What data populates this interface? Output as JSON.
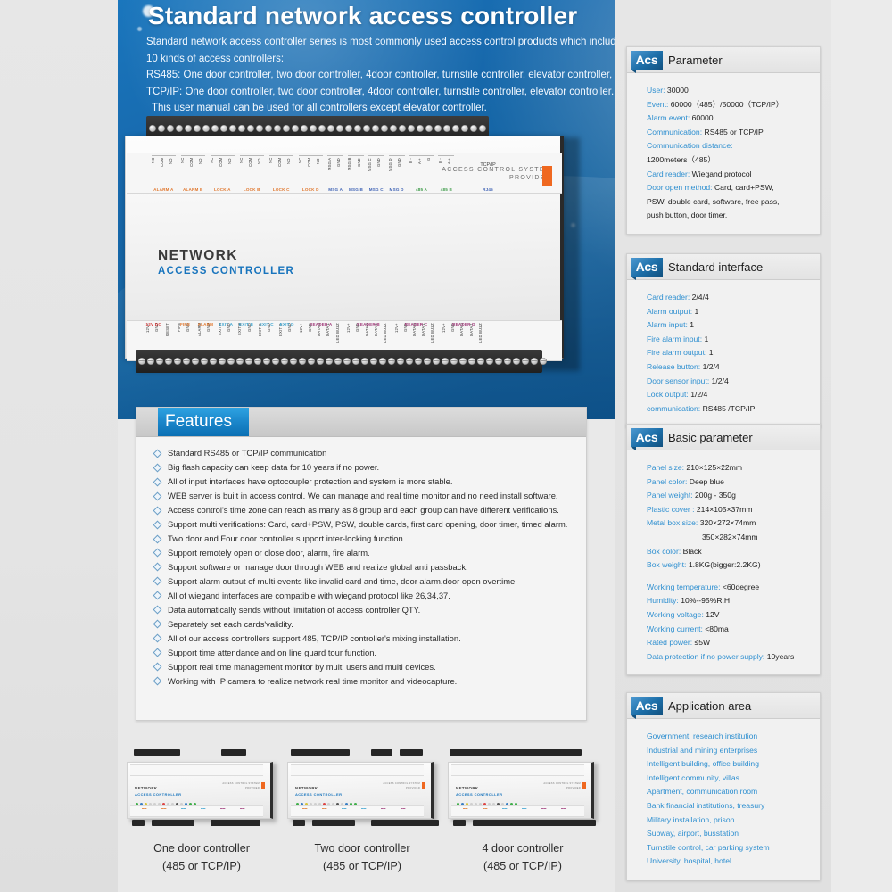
{
  "hero": {
    "title": "Standard network access controller",
    "lines": [
      "Standard network access controller series is most commonly used access control products which include",
      "10 kinds of access controllers:",
      "RS485:  One door controller, two door controller, 4door controller, turnstile controller, elevator controller,",
      "TCP/IP:  One door controller, two door controller, 4door controller, turnstile controller, elevator controller.",
      "This user manual can be used for all controllers except elevator controller."
    ]
  },
  "device": {
    "brand_line1": "ACCESS  CONTROL  SYSTEM",
    "brand_line2": "PROVIDER",
    "name_line1": "NETWORK",
    "name_line2": "ACCESS CONTROLLER",
    "top_groups": [
      {
        "name": "ALARM A",
        "color": "#e0762c",
        "pins": [
          "NC",
          "COM",
          "NO"
        ]
      },
      {
        "name": "ALARM B",
        "color": "#e0762c",
        "pins": [
          "NC",
          "COM",
          "NO"
        ]
      },
      {
        "name": "LOCK A",
        "color": "#e0762c",
        "pins": [
          "NC",
          "COM",
          "NO"
        ]
      },
      {
        "name": "LOCK B",
        "color": "#e0762c",
        "pins": [
          "NC",
          "COM",
          "NO"
        ]
      },
      {
        "name": "LOCK C",
        "color": "#e0762c",
        "pins": [
          "NC",
          "COM",
          "NO"
        ]
      },
      {
        "name": "LOCK D",
        "color": "#e0762c",
        "pins": [
          "NC",
          "COM",
          "NO"
        ]
      },
      {
        "name": "MSG A",
        "color": "#3f63b5",
        "pins": [
          "MSG A",
          "GND"
        ]
      },
      {
        "name": "MSG B",
        "color": "#3f63b5",
        "pins": [
          "MSG B",
          "GND"
        ]
      },
      {
        "name": "MSG C",
        "color": "#3f63b5",
        "pins": [
          "MSG C",
          "GND"
        ]
      },
      {
        "name": "MSG D",
        "color": "#3f63b5",
        "pins": [
          "MSG D",
          "GND"
        ]
      },
      {
        "name": "485 A",
        "color": "#3f9c4a",
        "pins": [
          "B -",
          "A +",
          "G"
        ]
      },
      {
        "name": "485 B",
        "color": "#3f9c4a",
        "pins": [
          "B -",
          "A +"
        ]
      },
      {
        "name": "RJ45",
        "color": "#3f63b5",
        "pins": []
      }
    ],
    "top_right_label": "TCP/IP",
    "bottom_groups": [
      {
        "name": "12V DC",
        "color": "#d33a3a",
        "pins": [
          "12V+",
          "GND"
        ]
      },
      {
        "name": "",
        "color": "#2b2b2b",
        "pins": [
          "RESET"
        ]
      },
      {
        "name": "FIRE",
        "color": "#e0762c",
        "pins": [
          "FIRE",
          "GND"
        ]
      },
      {
        "name": "ALARM",
        "color": "#e0762c",
        "pins": [
          "ALARM",
          "GND"
        ]
      },
      {
        "name": "EXIT A",
        "color": "#3aa3cf",
        "pins": [
          "EXIT A",
          "GND"
        ]
      },
      {
        "name": "EXIT B",
        "color": "#3aa3cf",
        "pins": [
          "EXIT B",
          "GND"
        ]
      },
      {
        "name": "EXIT C",
        "color": "#3aa3cf",
        "pins": [
          "EXIT C",
          "GND"
        ]
      },
      {
        "name": "EXIT D",
        "color": "#3aa3cf",
        "pins": [
          "EXIT D",
          "GND"
        ]
      },
      {
        "name": "READER A",
        "color": "#a03a7a",
        "pins": [
          "12V+",
          "GND",
          "DATA 0",
          "DATA 1",
          "LED BUZZ"
        ]
      },
      {
        "name": "READER B",
        "color": "#a03a7a",
        "pins": [
          "12V+",
          "GND",
          "DATA 0",
          "DATA 1",
          "LED BUZZ"
        ]
      },
      {
        "name": "READER C",
        "color": "#a03a7a",
        "pins": [
          "12V+",
          "GND",
          "DATA 0",
          "DATA 1",
          "LED BUZZ"
        ]
      },
      {
        "name": "READER D",
        "color": "#a03a7a",
        "pins": [
          "12V+",
          "GND",
          "DATA 0",
          "DATA 1",
          "LED BUZZ"
        ]
      }
    ]
  },
  "features": {
    "heading": "Features",
    "items": [
      "Standard RS485 or TCP/IP communication",
      "Big flash capacity can keep data for 10 years if no power.",
      "All of input interfaces have optocoupler protection and system is more stable.",
      "WEB server is built in access control. We can manage and real time monitor and no need install software.",
      "Access control's time zone can reach as many as 8 group and each group can have different verifications.",
      "Support multi verifications: Card, card+PSW, PSW, double cards, first card opening, door timer, timed alarm.",
      "Two door and Four door controller support  inter-locking function.",
      "Support remotely open or close door, alarm, fire alarm.",
      "Support software or manage door through WEB and realize global anti passback.",
      "Support alarm output of multi events like invalid card and time, door alarm,door open overtime.",
      "All of wiegand interfaces are compatible with wiegand protocol like 26,34,37.",
      "Data automatically sends without limitation of access controller QTY.",
      "Separately set each cards'validity.",
      "All of our access controllers support 485, TCP/IP controller's mixing installation.",
      "Support time attendance and on line guard tour function.",
      "Support real time management monitor by multi users and multi devices.",
      "Working with IP camera to realize network real time monitor and videocapture."
    ]
  },
  "sidebar": {
    "badge": "Acs",
    "parameter": {
      "title": "Parameter",
      "rows": [
        {
          "k": "User:",
          "v": " 30000"
        },
        {
          "k": "Event:",
          "v": " 60000（485）/50000（TCP/IP）"
        },
        {
          "k": "Alarm event:",
          "v": " 60000"
        },
        {
          "k": "Communication:",
          "v": " RS485 or TCP/IP"
        },
        {
          "k": "Communication  distance:",
          "v": ""
        },
        {
          "k": "",
          "v": "1200meters（485）"
        },
        {
          "k": "Card reader:",
          "v": " Wiegand protocol"
        },
        {
          "k": "Door open method:",
          "v": " Card, card+PSW,"
        },
        {
          "k": "",
          "v": "PSW, double card, software, free pass,"
        },
        {
          "k": "",
          "v": "push button, door timer."
        }
      ]
    },
    "standard_interface": {
      "title": "Standard  interface",
      "rows": [
        {
          "k": "Card reader:",
          "v": " 2/4/4"
        },
        {
          "k": "Alarm output:",
          "v": " 1"
        },
        {
          "k": "Alarm input:",
          "v": " 1"
        },
        {
          "k": "Fire alarm input:",
          "v": " 1"
        },
        {
          "k": "Fire alarm output:",
          "v": "  1"
        },
        {
          "k": "Release button:",
          "v": " 1/2/4"
        },
        {
          "k": "Door sensor input:",
          "v": " 1/2/4"
        },
        {
          "k": "Lock output:",
          "v": " 1/2/4"
        },
        {
          "k": "communication:",
          "v": " RS485 /TCP/IP"
        }
      ]
    },
    "basic_parameter": {
      "title": "Basic  parameter",
      "rows": [
        {
          "k": "Panel size:",
          "v": " 210×125×22mm"
        },
        {
          "k": "Panel color:",
          "v": " Deep blue"
        },
        {
          "k": "Panel weight:",
          "v": " 200g - 350g"
        },
        {
          "k": "Plastic cover :",
          "v": " 214×105×37mm"
        },
        {
          "k": "Metal box size:",
          "v": " 320×272×74mm"
        },
        {
          "k": "",
          "v": "350×282×74mm",
          "indent": true
        },
        {
          "k": "Box color:",
          "v": " Black"
        },
        {
          "k": "Box weight:",
          "v": " 1.8KG(bigger:2.2KG)"
        },
        {
          "gap": true
        },
        {
          "k": "Working temperature:",
          "v": " <60degree"
        },
        {
          "k": "Humidity:",
          "v": " 10%--95%R.H"
        },
        {
          "k": "Working voltage:",
          "v": " 12V"
        },
        {
          "k": "Working current:",
          "v": " <80ma"
        },
        {
          "k": "Rated power:",
          "v": " ≤5W"
        },
        {
          "k": "Data protection if no power supply:",
          "v": " 10years"
        }
      ]
    },
    "application_area": {
      "title": "Application  area",
      "items": [
        "Government, research institution",
        "Industrial and mining enterprises",
        "Intelligent building, office building",
        "Intelligent community, villas",
        "Apartment, communication room",
        "Bank financial institutions, treasury",
        "Military installation, prison",
        "Subway, airport, busstation",
        "Turnstile control, car parking system",
        "University, hospital, hotel"
      ]
    }
  },
  "variants": [
    {
      "line1": "One door controller",
      "line2": "(485 or TCP/IP)"
    },
    {
      "line1": "Two door controller",
      "line2": "(485 or TCP/IP)"
    },
    {
      "line1": "4 door controller",
      "line2": "(485 or TCP/IP)"
    }
  ],
  "colors": {
    "hero_blue": "#15639f",
    "accent_blue": "#2e8fd0",
    "orange": "#ef6820",
    "feature_tab": "#1b87cb"
  }
}
